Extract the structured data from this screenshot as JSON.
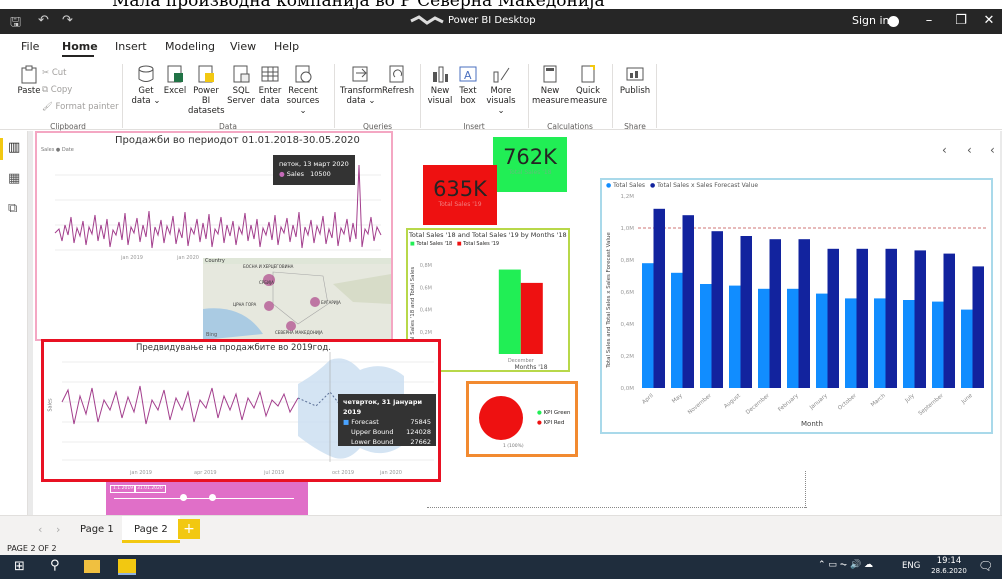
{
  "caption": "Мала производна компанија во Р Северна Македонија",
  "app": {
    "title": "Power BI Desktop",
    "signin": "Sign in"
  },
  "menu": [
    "File",
    "Home",
    "Insert",
    "Modeling",
    "View",
    "Help"
  ],
  "ribbon": {
    "clipboard": {
      "paste": "Paste",
      "cut": "Cut",
      "copy": "Copy",
      "format_painter": "Format painter",
      "label": "Clipboard"
    },
    "data": {
      "label": "Data",
      "buttons": [
        {
          "line1": "Get",
          "line2": "data ⌄"
        },
        {
          "line1": "Excel",
          "line2": ""
        },
        {
          "line1": "Power BI",
          "line2": "datasets"
        },
        {
          "line1": "SQL",
          "line2": "Server"
        },
        {
          "line1": "Enter",
          "line2": "data"
        },
        {
          "line1": "Recent",
          "line2": "sources ⌄"
        }
      ]
    },
    "queries": {
      "label": "Queries",
      "transform_1": "Transform",
      "transform_2": "data ⌄",
      "refresh": "Refresh"
    },
    "insert": {
      "label": "Insert",
      "buttons": [
        {
          "line1": "New",
          "line2": "visual"
        },
        {
          "line1": "Text",
          "line2": "box"
        },
        {
          "line1": "More",
          "line2": "visuals ⌄"
        }
      ]
    },
    "calculations": {
      "label": "Calculations",
      "new_1": "New",
      "new_2": "measure",
      "quick_1": "Quick",
      "quick_2": "measure"
    },
    "share": {
      "label": "Share",
      "publish": "Publish"
    }
  },
  "visuals": {
    "sales_line": {
      "title": "Продажби во периодот 01.01.2018-30.05.2020",
      "legend": "Sales ● Date",
      "tooltip_date": "петок, 13 март 2020",
      "tooltip_metric": "Sales",
      "tooltip_value": "10500",
      "xlabels": [
        "jan 2019",
        "jan 2020"
      ]
    },
    "map": {
      "title": "Country",
      "labels": [
        "БОСНА И ХЕРЦЕГОВИНА",
        "СРБИЈА",
        "ЦРНА ГОРА",
        "БУГАРИЈА",
        "СЕВЕРНА МАКЕДОНИЈА"
      ],
      "logo": "Bing"
    },
    "card_2018": {
      "value": "762K",
      "label": "Total Sales '18",
      "color": "#21ee55"
    },
    "card_2019": {
      "value": "635K",
      "label": "Total Sales '19",
      "color": "#ee1111"
    },
    "forecast": {
      "title": "Предвидување на продажбите во 2019год.",
      "tooltip_date": "четврток, 31 јануари 2019",
      "rows": [
        {
          "k": "Forecast",
          "v": "75845"
        },
        {
          "k": "Upper Bound",
          "v": "124028"
        },
        {
          "k": "Lower Bound",
          "v": "27662"
        }
      ],
      "ylabel": "Sales",
      "xlabels": [
        "jan 2019",
        "apr 2019",
        "jul 2019",
        "oct 2019",
        "jan 2020"
      ]
    },
    "slicer": {
      "from": "1.1.2019",
      "to": "31.01.2020"
    },
    "kpi": {
      "label": "1 (100%)",
      "legend": [
        "KPI Green",
        "KPI Red"
      ]
    },
    "bottom_title": ""
  },
  "chart_data": [
    {
      "type": "bar",
      "title": "Total Sales '18 and Total Sales '19 by Months '18",
      "xlabel": "Months '18",
      "ylabel": "Total Sales '18 and Total Sales",
      "categories": [
        "December"
      ],
      "series": [
        {
          "name": "Total Sales '18",
          "color": "#21ee55",
          "values": [
            0.76
          ]
        },
        {
          "name": "Total Sales '19",
          "color": "#ee1111",
          "values": [
            0.64
          ]
        }
      ],
      "yticks": [
        "0,2M",
        "0,4M",
        "0,6M",
        "0,8M"
      ],
      "ylim": [
        0,
        0.9
      ]
    },
    {
      "type": "bar",
      "title": "",
      "xlabel": "Month",
      "ylabel": "Total Sales and Total Sales x Sales Forecast Value",
      "legend": [
        "Total Sales",
        "Total Sales x Sales Forecast Value"
      ],
      "categories": [
        "April",
        "May",
        "November",
        "August",
        "December",
        "February",
        "January",
        "October",
        "March",
        "July",
        "September",
        "June"
      ],
      "series": [
        {
          "name": "Total Sales",
          "color": "#118dff",
          "values": [
            0.78,
            0.72,
            0.65,
            0.64,
            0.62,
            0.62,
            0.59,
            0.56,
            0.56,
            0.55,
            0.54,
            0.49
          ]
        },
        {
          "name": "Total Sales x Sales Forecast Value",
          "color": "#12239e",
          "values": [
            1.12,
            1.08,
            0.98,
            0.95,
            0.93,
            0.93,
            0.87,
            0.87,
            0.87,
            0.86,
            0.84,
            0.76
          ]
        }
      ],
      "yticks": [
        "0,0M",
        "0,2M",
        "0,4M",
        "0,6M",
        "0,8M",
        "1,0M",
        "1,2M"
      ],
      "ylim": [
        0,
        1.2
      ],
      "reference_line": 1.0
    }
  ],
  "page_tabs": [
    "Page 1",
    "Page 2"
  ],
  "add_page": "+",
  "status": "PAGE 2 OF 2",
  "taskbar": {
    "lang": "ENG",
    "time": "19:14",
    "date": "28.6.2020"
  }
}
